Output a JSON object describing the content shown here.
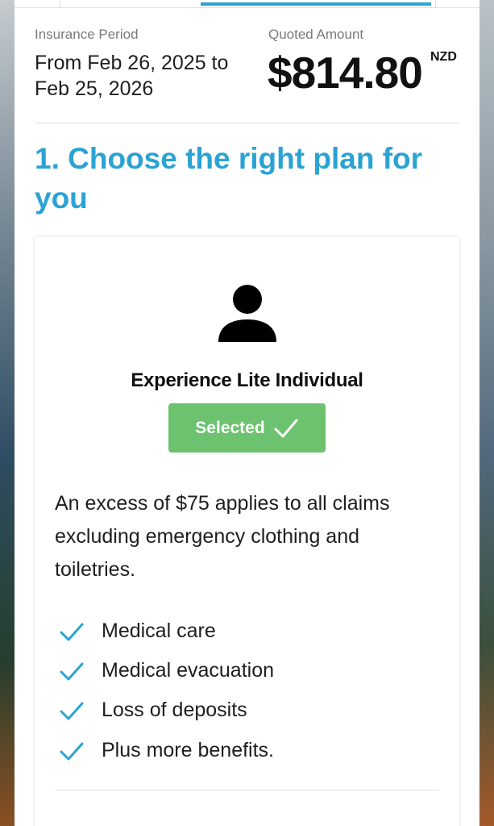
{
  "insurance": {
    "period_label": "Insurance Period",
    "period_text": "From Feb 26, 2025 to Feb 25, 2026",
    "amount_label": "Quoted Amount",
    "amount": "$814.80",
    "currency": "NZD"
  },
  "section": {
    "title": "1. Choose the right plan for you"
  },
  "plan": {
    "icon": "person-icon",
    "name": "Experience Lite Individual",
    "selected_label": "Selected",
    "selected_color": "#6cc26e",
    "excess_text": "An excess of $75 applies to all claims excluding emergency clothing and toiletries.",
    "benefits": [
      "Medical care",
      "Medical evacuation",
      "Loss of deposits",
      "Plus more benefits."
    ]
  },
  "colors": {
    "accent": "#2aa3d3",
    "check": "#2aa3d3"
  }
}
